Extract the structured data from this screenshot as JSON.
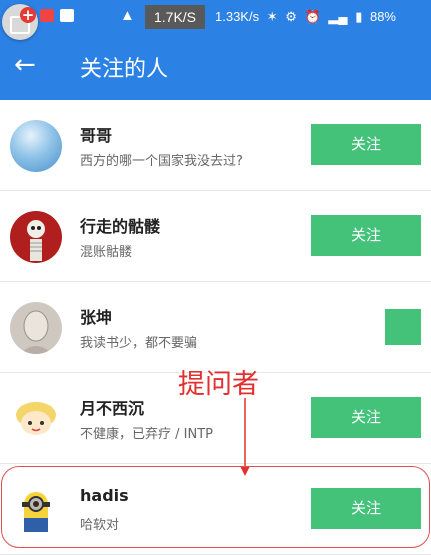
{
  "status_bar": {
    "net_speed_box": "1.7K/S",
    "net_speed": "1.33K/s",
    "battery": "88%"
  },
  "app_bar": {
    "title": "关注的人"
  },
  "users": [
    {
      "name": "哥哥",
      "bio": "西方的哪一个国家我没去过?",
      "button": "关注"
    },
    {
      "name": "行走的骷髅",
      "bio": "混账骷髅",
      "button": "关注"
    },
    {
      "name": "张坤",
      "bio": "我读书少，都不要骗",
      "button": ""
    },
    {
      "name": "月不西沉",
      "bio": "不健康，已弃疗 / INTP",
      "button": "关注"
    },
    {
      "name": "hadis",
      "bio": "哈软对",
      "button": "关注"
    }
  ],
  "annotation": {
    "text": "提问者",
    "color": "#e23030"
  },
  "colors": {
    "primary": "#2c81e4",
    "follow_button": "#44c27a"
  }
}
